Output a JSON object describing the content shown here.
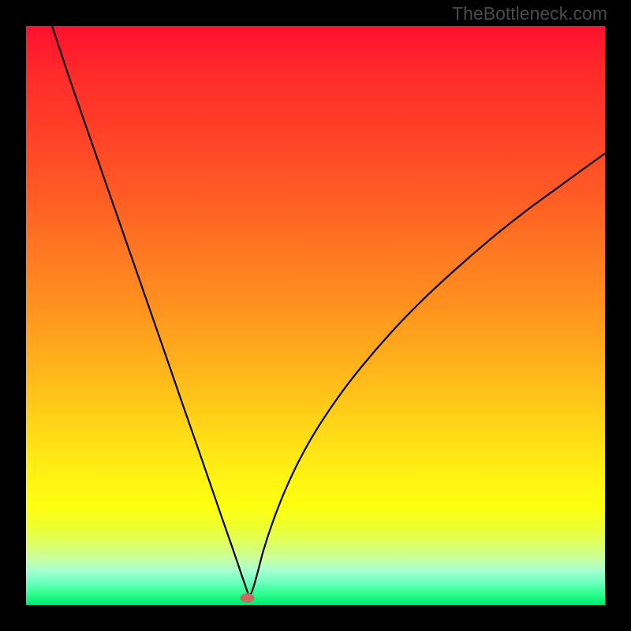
{
  "attribution": "TheBottleneck.com",
  "colors": {
    "background": "#000000",
    "curve": "#000000",
    "marker": "#c96b60",
    "gradient_top": "#ff1030",
    "gradient_bottom": "#00e870"
  },
  "chart_data": {
    "type": "line",
    "title": "",
    "xlabel": "",
    "ylabel": "",
    "xlim": [
      0,
      100
    ],
    "ylim": [
      0,
      100
    ],
    "x": [
      4.5,
      8,
      12,
      16,
      20,
      24,
      27,
      30,
      32,
      34,
      35.5,
      36.5,
      37.2,
      37.8,
      38.2,
      38.6,
      39.2,
      40,
      41,
      42.5,
      44.5,
      47,
      50,
      54,
      58,
      63,
      68,
      74,
      80,
      86,
      92,
      100
    ],
    "y": [
      100,
      89.5,
      78,
      66.5,
      55,
      43.5,
      34.8,
      26.2,
      20.4,
      14.6,
      10.3,
      7.4,
      5.3,
      3.6,
      2.4,
      1.6,
      2.8,
      5.6,
      9.4,
      14,
      19.2,
      24.6,
      30,
      36,
      41.2,
      47,
      52.2,
      57.8,
      63,
      67.8,
      72.2,
      78
    ],
    "marker": {
      "x": 38.2,
      "y": 1.2
    },
    "note": "V-shaped bottleneck curve; minimum near x≈38 on 0–100 normalized axes; background is heat gradient green→red."
  }
}
